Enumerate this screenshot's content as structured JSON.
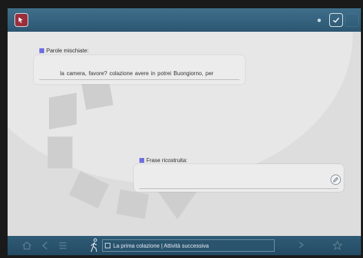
{
  "words_section": {
    "label": "Parole mischiate:",
    "words": "la  camera,  favore?  colazione  avere  in  potrei  Buongiorno,  per"
  },
  "answer_section": {
    "label": "Frase ricostruita:",
    "value": ""
  },
  "footer": {
    "breadcrumb": "La prima colazione | Attività successiva"
  },
  "colors": {
    "bar": "#2c5671",
    "workspace": "#dddddd",
    "label_marker": "#6e6ee0"
  }
}
